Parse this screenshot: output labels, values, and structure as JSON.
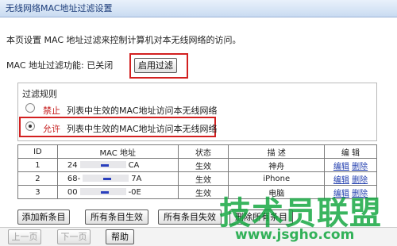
{
  "page": {
    "title": "无线网络MAC地址过滤设置"
  },
  "intro": {
    "description": "本页设置 MAC 地址过滤来控制计算机对本无线网络的访问。"
  },
  "filter_status": {
    "label": "MAC 地址过滤功能: 已关闭",
    "enable_button": "启用过滤"
  },
  "rules": {
    "title": "过滤规则",
    "options": [
      {
        "keyword": "禁止",
        "text": "列表中生效的MAC地址访问本无线网络",
        "selected": false
      },
      {
        "keyword": "允许",
        "text": "列表中生效的MAC地址访问本无线网络",
        "selected": true
      }
    ]
  },
  "table": {
    "headers": {
      "id": "ID",
      "mac": "MAC 地址",
      "status": "状态",
      "desc": "描 述",
      "edit": "编 辑"
    },
    "rows": [
      {
        "id": "1",
        "mac_prefix": "24",
        "mac_suffix": "CA",
        "status": "生效",
        "desc": "神舟",
        "edit": "编辑",
        "delete": "删除"
      },
      {
        "id": "2",
        "mac_prefix": "68-",
        "mac_suffix": "7A",
        "status": "生效",
        "desc": "iPhone",
        "edit": "编辑",
        "delete": "删除"
      },
      {
        "id": "3",
        "mac_prefix": "00",
        "mac_suffix": "-0E",
        "status": "生效",
        "desc": "电脑",
        "edit": "编辑",
        "delete": "删除"
      }
    ]
  },
  "actions": {
    "add": "添加新条目",
    "enable_all": "所有条目生效",
    "disable_all": "所有条目失效",
    "delete_all": "删除所有条目"
  },
  "nav": {
    "prev": "上一页",
    "next": "下一页",
    "help": "帮助"
  },
  "watermark": {
    "brand": "技术员联盟",
    "url": "www.jsgho.com"
  },
  "colors": {
    "highlight": "#d22020",
    "keyword": "#c62020",
    "link": "#1f3cae",
    "watermark": "#0fa53c"
  }
}
